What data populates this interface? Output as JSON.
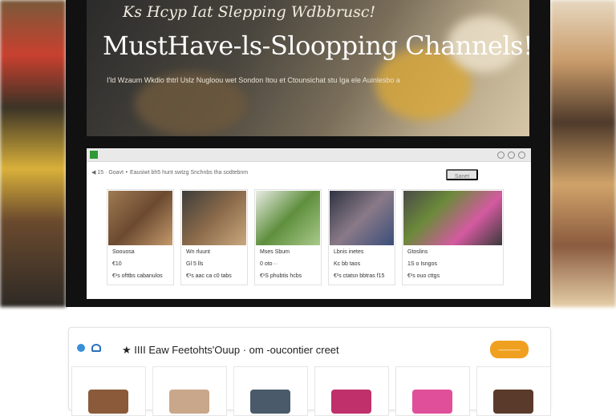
{
  "hero": {
    "kicker": "Ks Hcyp Iat Slepping Wdbbrusc!",
    "title": "MustHave-ls-Sloopping Channels!",
    "subtitle": "I'ld  Wzaum  Wkdio  thtrl Uslz  Nugloou  wet  Sondon Itou et  Ctounsichat stu  Iga ele  Auinlesbo a"
  },
  "browser": {
    "tab_label": "",
    "breadcrumb": "◀   15  ·  Goavt   ‣  Eausiwt bh5 hunt  swtzg  Snchnbs tha  sodtebnm",
    "search_label": "Sanet",
    "products": [
      {
        "name": "Soouosa",
        "price": "€10",
        "meta": "€¹s ofttbs cabanulos"
      },
      {
        "name": "Wn rluunt",
        "price": "Gl 5 lls",
        "meta": "€¹s aac ca c0 tabs"
      },
      {
        "name": "Mses Sbum",
        "price": "0 oto ··",
        "meta": "€¹S phubtis hcbs"
      },
      {
        "name": "Lbnis inetes",
        "price": "Kc bb taos",
        "meta": "€¹s ctatsn bbtras f15"
      },
      {
        "name": "Gtoslins",
        "price": "1S o Isngos",
        "meta": "€¹s ouo  cttgs"
      }
    ]
  },
  "bottom": {
    "title": "★ IIII Eaw  Feetohts'Ouup  ·  om  -oucontier  creet",
    "button_label": "———"
  },
  "colors": {
    "accent": "#f0a020",
    "browser_green": "#2f9a35"
  }
}
